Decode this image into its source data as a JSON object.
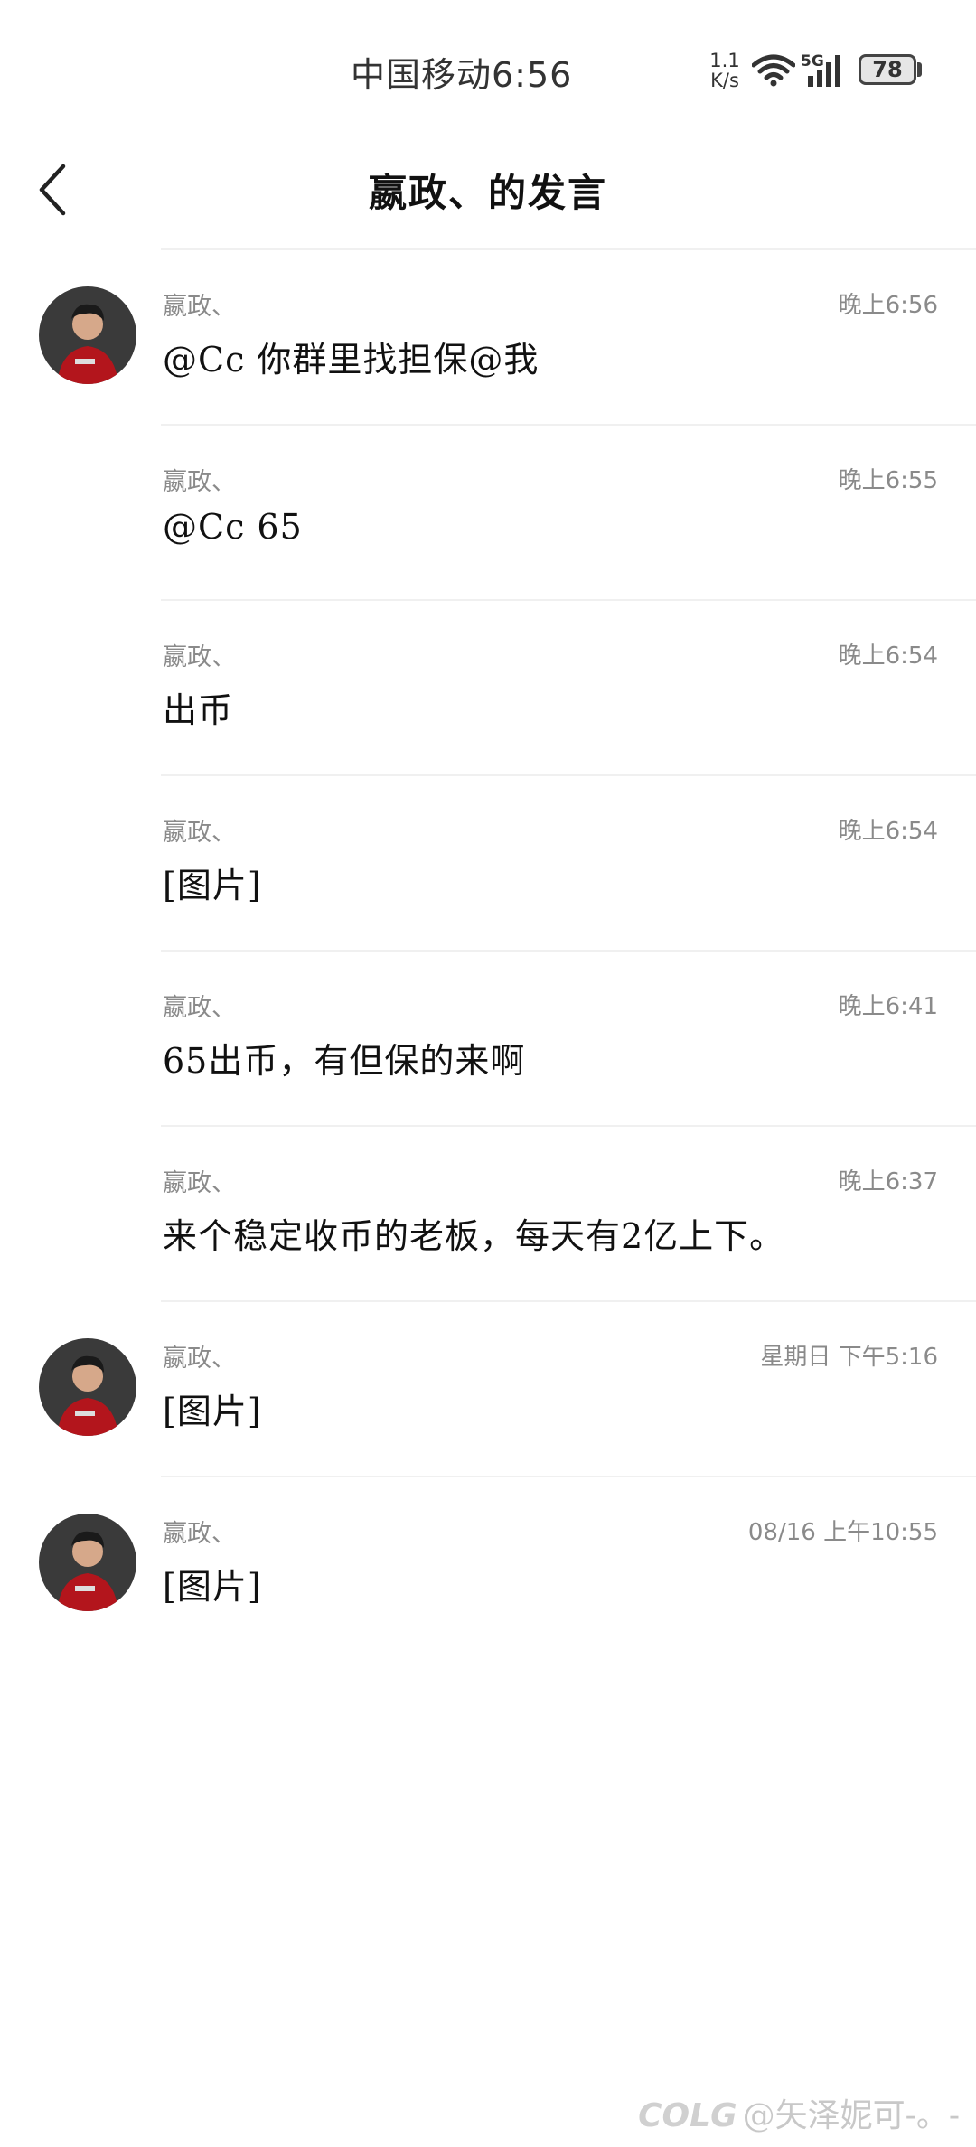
{
  "status_bar": {
    "carrier_time": "中国移动6:56",
    "net_speed_value": "1.1",
    "net_speed_unit": "K/s",
    "network": "5G",
    "battery": "78"
  },
  "header": {
    "title": "嬴政、的发言"
  },
  "messages": [
    {
      "sender": "嬴政、",
      "time": "晚上6:56",
      "text": "@Cc 你群里找担保@我"
    },
    {
      "sender": "嬴政、",
      "time": "晚上6:55",
      "text": "@Cc 65"
    },
    {
      "sender": "嬴政、",
      "time": "晚上6:54",
      "text": "出币"
    },
    {
      "sender": "嬴政、",
      "time": "晚上6:54",
      "text": "[图片]"
    },
    {
      "sender": "嬴政、",
      "time": "晚上6:41",
      "text": "65出币，有但保的来啊"
    },
    {
      "sender": "嬴政、",
      "time": "晚上6:37",
      "text": "来个稳定收币的老板，每天有2亿上下。"
    },
    {
      "sender": "嬴政、",
      "time": "星期日 下午5:16",
      "text": "[图片]"
    },
    {
      "sender": "嬴政、",
      "time": "08/16 上午10:55",
      "text": "[图片]"
    }
  ],
  "watermark": {
    "brand": "COLG",
    "text": "@矢泽妮可-。-"
  },
  "colors": {
    "avatar_red": "#b3151c",
    "meta_gray": "#8a8a8a"
  }
}
